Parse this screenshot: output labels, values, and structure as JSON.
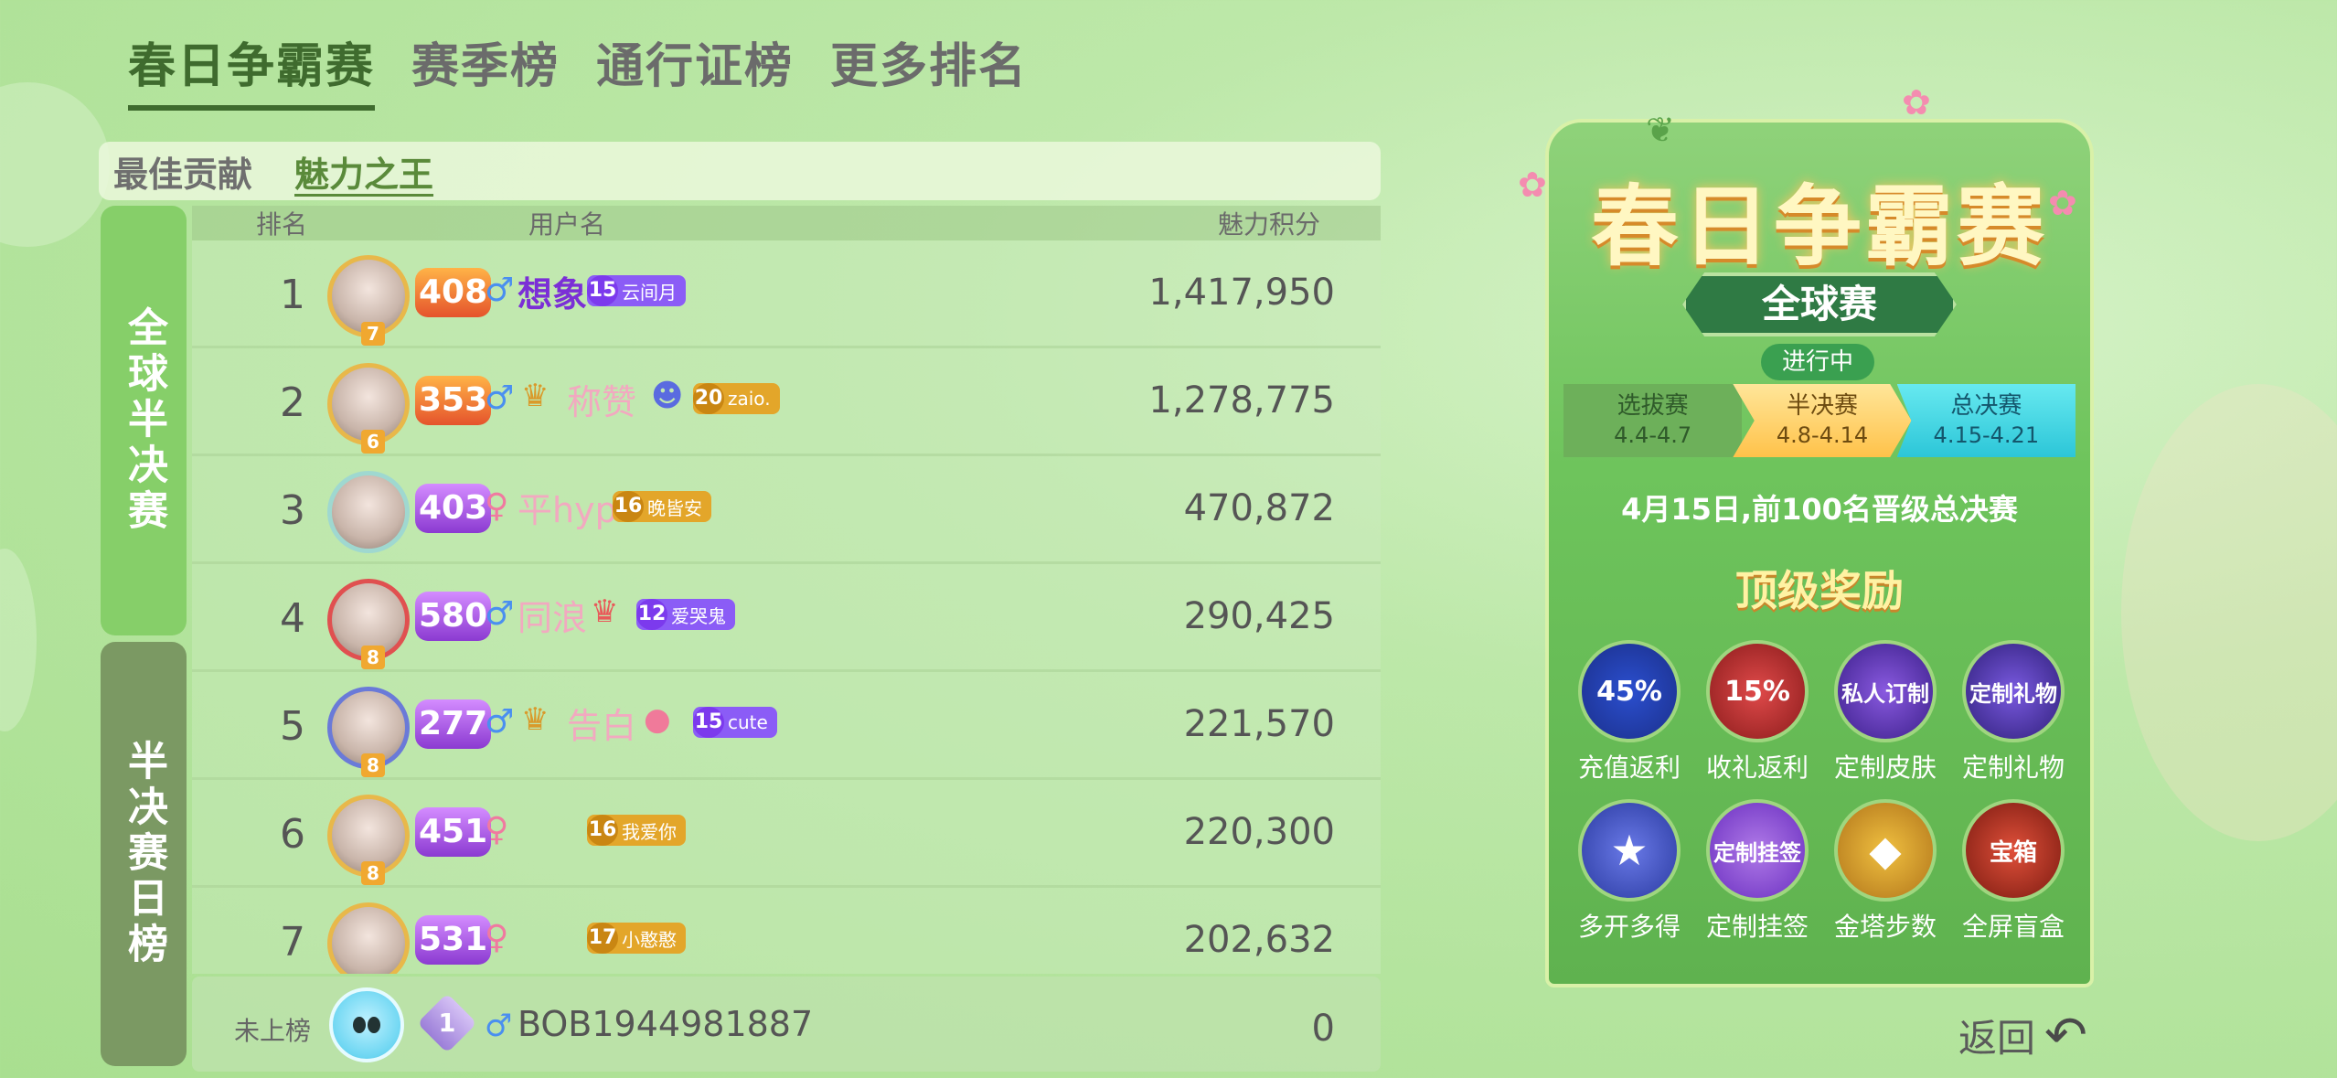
{
  "top_tabs": [
    "春日争霸赛",
    "赛季榜",
    "通行证榜",
    "更多排名"
  ],
  "sub_tabs": [
    "最佳贡献",
    "魅力之王"
  ],
  "side_tabs": [
    "全球半决赛",
    "半决赛日榜"
  ],
  "table": {
    "headers": {
      "rank": "排名",
      "user": "用户名",
      "score": "魅力积分"
    },
    "rows": [
      {
        "rank": "1",
        "avatar_level": "7",
        "level": "408",
        "level_color": "orange",
        "gender": "♂",
        "name": "想象",
        "badge_num": "15",
        "badge_text": "云间月",
        "badge_color": "purple",
        "score": "1,417,950"
      },
      {
        "rank": "2",
        "avatar_level": "6",
        "level": "353",
        "level_color": "orange",
        "gender": "♂",
        "name": "称赞",
        "badge_num": "20",
        "badge_text": "zaio.",
        "badge_color": "gold",
        "score": "1,278,775"
      },
      {
        "rank": "3",
        "avatar_level": "",
        "level": "403",
        "level_color": "purple",
        "gender": "♀",
        "name": "平hyp",
        "badge_num": "16",
        "badge_text": "晚皆安",
        "badge_color": "gold",
        "score": "470,872"
      },
      {
        "rank": "4",
        "avatar_level": "8",
        "level": "580",
        "level_color": "purple",
        "gender": "♂",
        "name": "同浪",
        "badge_num": "12",
        "badge_text": "爱哭鬼",
        "badge_color": "purple",
        "score": "290,425"
      },
      {
        "rank": "5",
        "avatar_level": "8",
        "level": "277",
        "level_color": "purple",
        "gender": "♂",
        "name": "告白",
        "badge_num": "15",
        "badge_text": "cute",
        "badge_color": "purple",
        "score": "221,570"
      },
      {
        "rank": "6",
        "avatar_level": "8",
        "level": "451",
        "level_color": "purple",
        "gender": "♀",
        "name": "",
        "badge_num": "16",
        "badge_text": "我爱你",
        "badge_color": "gold",
        "score": "220,300"
      },
      {
        "rank": "7",
        "avatar_level": "",
        "level": "531",
        "level_color": "purple",
        "gender": "♀",
        "name": "",
        "badge_num": "17",
        "badge_text": "小憨憨",
        "badge_color": "gold",
        "score": "202,632"
      }
    ]
  },
  "me": {
    "status": "未上榜",
    "level": "1",
    "gender": "♂",
    "name": "BOB1944981887",
    "score": "0"
  },
  "event": {
    "title": "春日争霸赛",
    "subtitle": "全球赛",
    "status": "进行中",
    "stages": [
      {
        "name": "选拔赛",
        "dates": "4.4-4.7"
      },
      {
        "name": "半决赛",
        "dates": "4.8-4.14"
      },
      {
        "name": "总决赛",
        "dates": "4.15-4.21"
      }
    ],
    "notice": "4月15日,前100名晋级总决赛",
    "rewards_title": "顶级奖励",
    "rewards": [
      {
        "icon_text": "45%",
        "label": "充值返利"
      },
      {
        "icon_text": "15%",
        "label": "收礼返利"
      },
      {
        "icon_text": "私人订制",
        "label": "定制皮肤"
      },
      {
        "icon_text": "定制礼物",
        "label": "定制礼物"
      },
      {
        "icon_text": "★",
        "label": "多开多得"
      },
      {
        "icon_text": "定制挂签",
        "label": "定制挂签"
      },
      {
        "icon_text": "◆",
        "label": "金塔步数"
      },
      {
        "icon_text": "宝箱",
        "label": "全屏盲盒"
      }
    ]
  },
  "back_label": "返回"
}
